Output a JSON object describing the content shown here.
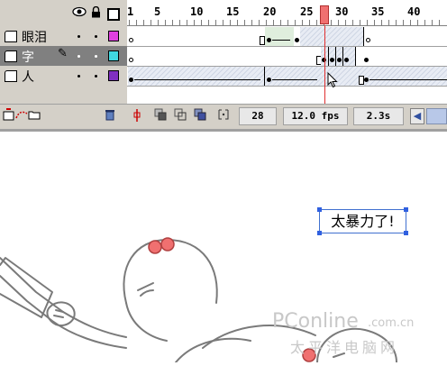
{
  "timeline": {
    "ruler_labels": [
      "1",
      "5",
      "10",
      "15",
      "20",
      "25",
      "30",
      "35",
      "40"
    ],
    "header_icons": {
      "eye": "eye-icon",
      "lock": "lock-icon",
      "outline": "outline-box-icon"
    },
    "layers": [
      {
        "name": "眼泪",
        "color": "#e040e0",
        "selected": false
      },
      {
        "name": "字",
        "color": "#40d8e0",
        "selected": true
      },
      {
        "name": "人",
        "color": "#8030c0",
        "selected": false
      }
    ],
    "current_frame": "28",
    "frame_rate": "12.0 fps",
    "elapsed_time": "2.3s"
  },
  "stage": {
    "text_box": "太暴力了!",
    "watermark_main": "PConline",
    "watermark_domain": ".com.cn",
    "watermark_cn": "太平洋电脑网"
  },
  "colors": {
    "playhead": "#e03030",
    "panel": "#d4d0c8",
    "selection_handles": "#3060e0",
    "character_bows": "#f07070"
  }
}
